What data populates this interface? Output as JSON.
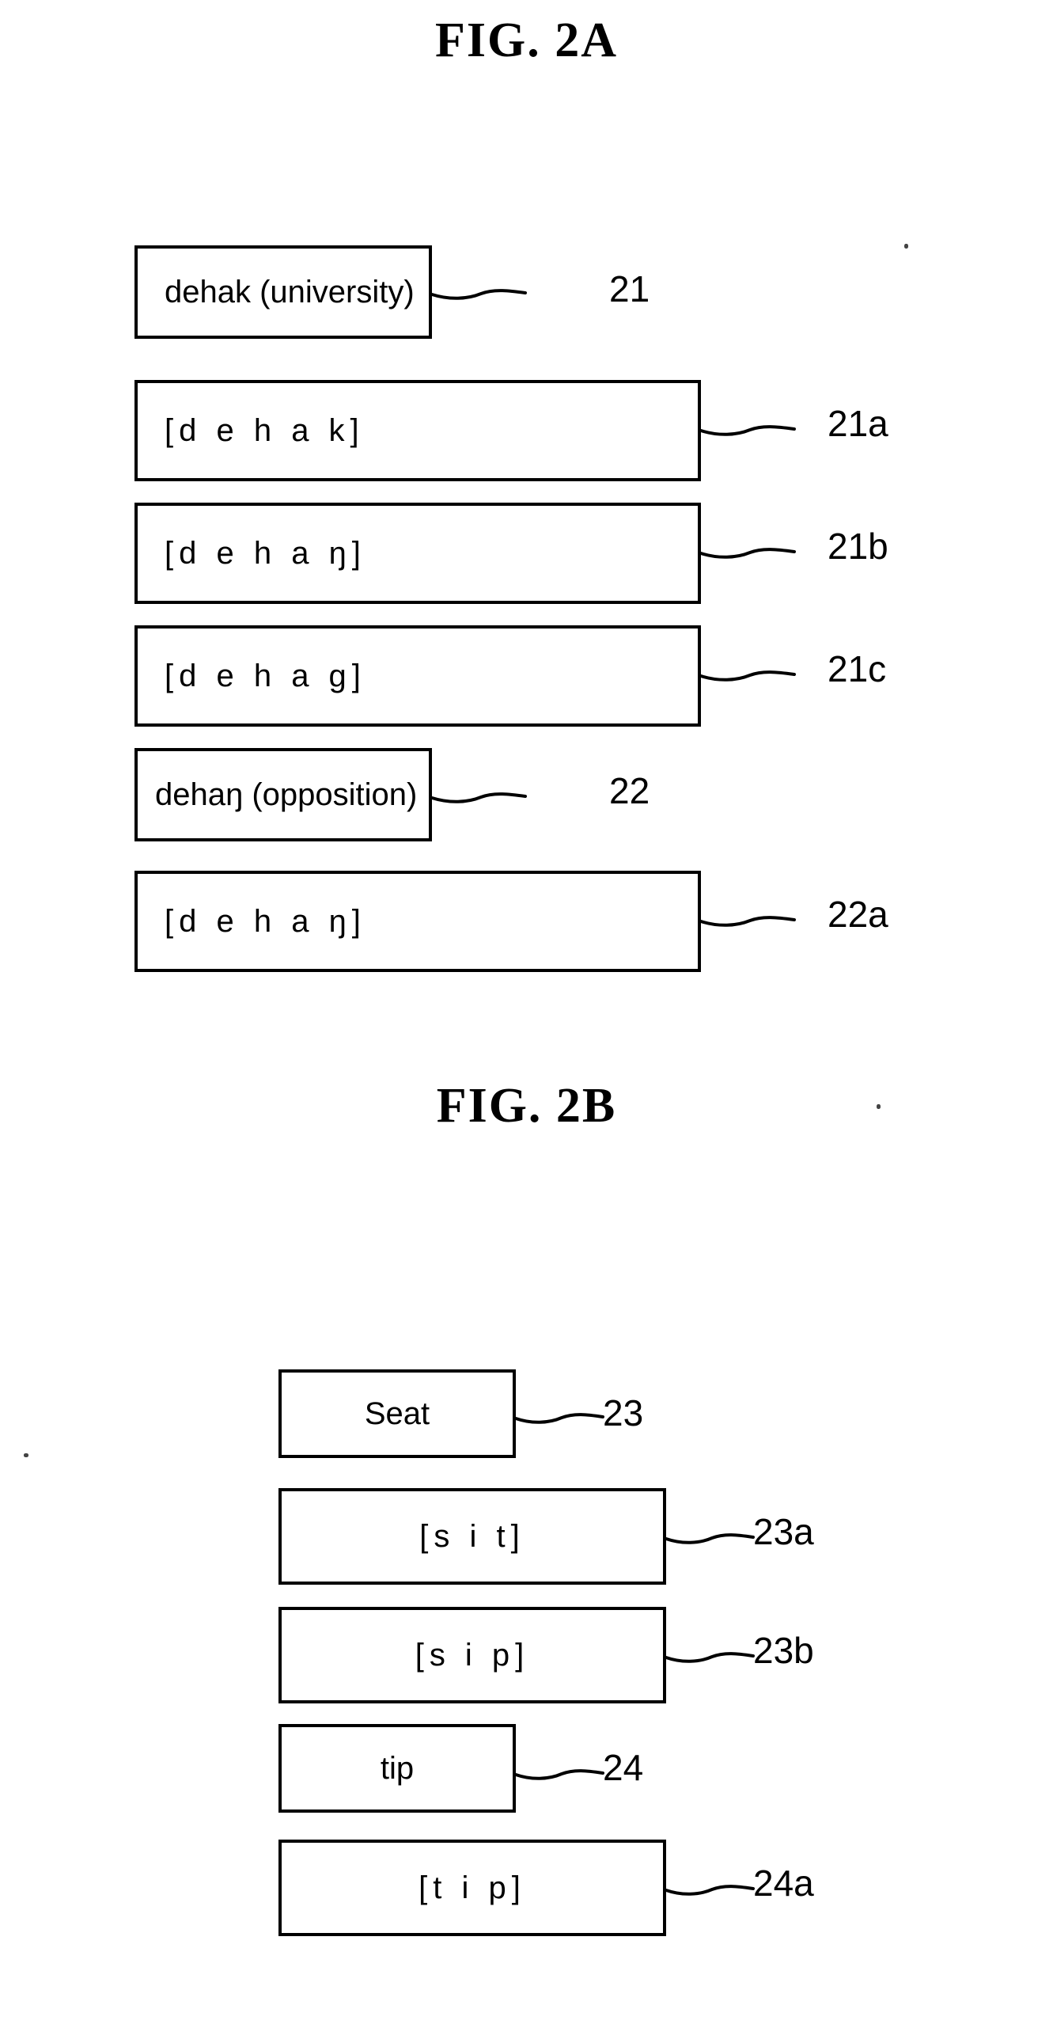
{
  "document": {
    "type": "patent-figure-sheet",
    "background_color": "#ffffff",
    "ink_color": "#000000"
  },
  "figures": [
    {
      "id": "fig-2a",
      "title": "FIG.  2A",
      "boxes": [
        {
          "id": "box-21",
          "text": "dehak (university)",
          "ref": "21",
          "align": "left",
          "phonetic": false
        },
        {
          "id": "box-21a",
          "text": "[d e h a k]",
          "ref": "21a",
          "align": "left",
          "phonetic": true
        },
        {
          "id": "box-21b",
          "text": "[d e h a ŋ]",
          "ref": "21b",
          "align": "left",
          "phonetic": true
        },
        {
          "id": "box-21c",
          "text": "[d e h a g]",
          "ref": "21c",
          "align": "left",
          "phonetic": true
        },
        {
          "id": "box-22",
          "text": "dehaŋ (opposition)",
          "ref": "22",
          "align": "left",
          "phonetic": false
        },
        {
          "id": "box-22a",
          "text": "[d e h a ŋ]",
          "ref": "22a",
          "align": "left",
          "phonetic": true
        }
      ]
    },
    {
      "id": "fig-2b",
      "title": "FIG.  2B",
      "boxes": [
        {
          "id": "box-23",
          "text": "Seat",
          "ref": "23",
          "align": "center",
          "phonetic": false
        },
        {
          "id": "box-23a",
          "text": "[s i t]",
          "ref": "23a",
          "align": "center",
          "phonetic": true
        },
        {
          "id": "box-23b",
          "text": "[s i p]",
          "ref": "23b",
          "align": "center",
          "phonetic": true
        },
        {
          "id": "box-24",
          "text": "tip",
          "ref": "24",
          "align": "center",
          "phonetic": false
        },
        {
          "id": "box-24a",
          "text": "[t i p]",
          "ref": "24a",
          "align": "center",
          "phonetic": true
        }
      ]
    }
  ]
}
